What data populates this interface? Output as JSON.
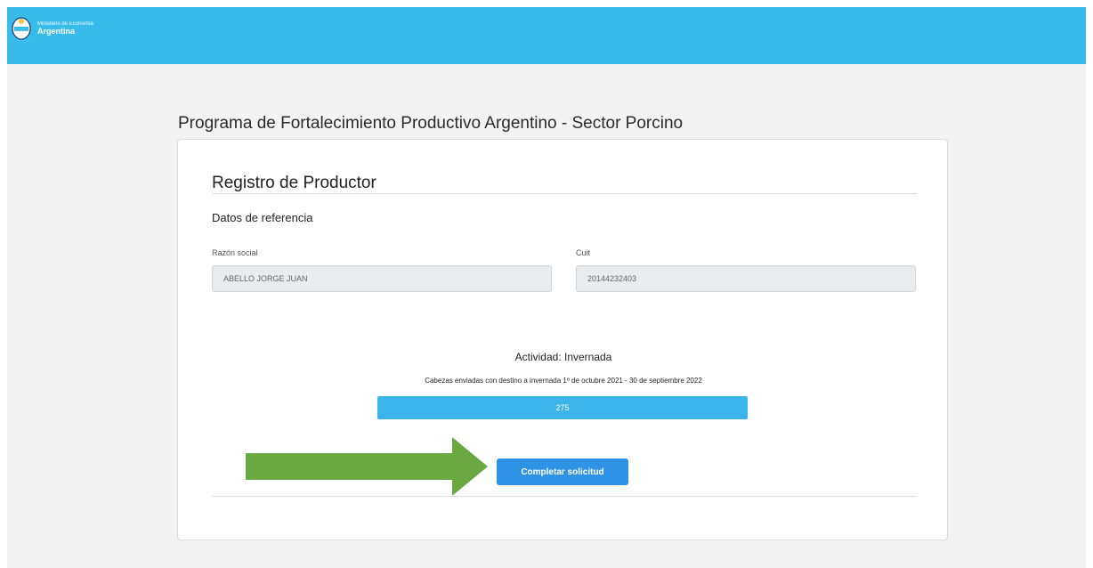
{
  "header": {
    "ministry": "Ministerio de Economía",
    "country": "Argentina",
    "background_color": "#37bbe9"
  },
  "page": {
    "title": "Programa de Fortalecimiento Productivo Argentino - Sector Porcino"
  },
  "form": {
    "section_title": "Registro de Productor",
    "subsection_title": "Datos de referencia",
    "razon_social": {
      "label": "Razón social",
      "value": "ABELLO JORGE JUAN"
    },
    "cuit": {
      "label": "Cuit",
      "value": "20144232403"
    },
    "activity": {
      "title": "Actividad: Invernada",
      "description": "Cabezas enviadas con destino a invernada 1º de octubre 2021 - 30 de septiembre 2022",
      "value": "275",
      "fill_percent": 100
    },
    "submit_label": "Completar solicitud",
    "button_color": "#2e93e6"
  },
  "annotation": {
    "icon": "green-arrow-icon",
    "color": "#6aa842"
  }
}
